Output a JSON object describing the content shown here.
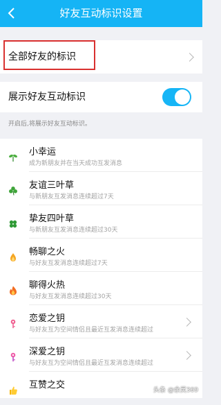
{
  "header": {
    "title": "好友互动标识设置"
  },
  "all_friends_row": {
    "label": "全部好友的标识"
  },
  "toggle_row": {
    "label": "展示好友互动标识",
    "enabled": true
  },
  "hint": "开启后,将展示好友互动标识。",
  "items": [
    {
      "name": "小幸运",
      "desc": "成为新朋友并在当天成功互发消息",
      "icon": "sprout-icon"
    },
    {
      "name": "友谊三叶草",
      "desc": "与新朋友互发消息连续超过7天",
      "icon": "three-leaf-clover-icon"
    },
    {
      "name": "挚友四叶草",
      "desc": "与新朋友互发消息连续超过30天",
      "icon": "four-leaf-clover-icon"
    },
    {
      "name": "畅聊之火",
      "desc": "与好友互发消息连续超过7天",
      "icon": "small-flame-icon"
    },
    {
      "name": "聊得火热",
      "desc": "与好友互发消息连续超过30天",
      "icon": "big-flame-icon"
    },
    {
      "name": "恋爱之钥",
      "desc": "与好友互为空间情侣且最近互发消息连续超过",
      "icon": "pink-key-icon"
    },
    {
      "name": "深爱之钥",
      "desc": "与好友互为空间情侣且最近互发消息连续超过",
      "icon": "purple-key-icon"
    },
    {
      "name": "互赞之交",
      "desc": "",
      "icon": "thumbs-up-icon"
    }
  ],
  "watermark": "头条 @余灵369",
  "colors": {
    "accent": "#15b4f5",
    "highlight_box": "#d9302f"
  }
}
